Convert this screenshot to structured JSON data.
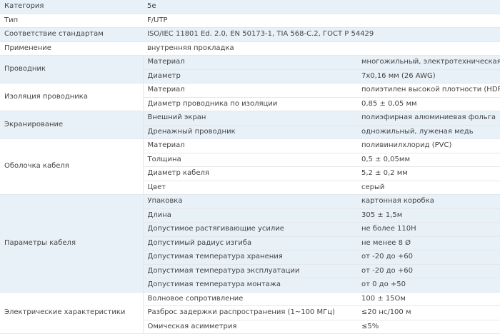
{
  "spec_rows": [
    {
      "label": "Категория",
      "value": "5e"
    },
    {
      "label": "Тип",
      "value": "F/UTP"
    },
    {
      "label": "Соответствие стандартам",
      "value": "ISO/IEC 11801 Ed. 2.0, EN 50173-1, TIA 568-C.2, ГОСТ Р 54429"
    },
    {
      "label": "Применение",
      "value": "внутренняя прокладка"
    }
  ],
  "groups": [
    {
      "title": "Проводник",
      "rows": [
        {
          "param": "Материал",
          "value": "многожильный, электротехническая медь"
        },
        {
          "param": "Диаметр",
          "value": "7x0,16 мм (26 AWG)"
        }
      ]
    },
    {
      "title": "Изоляция проводника",
      "rows": [
        {
          "param": "Материал",
          "value": "полиэтилен высокой плотности (HDPE)"
        },
        {
          "param": "Диаметр проводника по изоляции",
          "value": "0,85 ± 0,05 мм"
        }
      ]
    },
    {
      "title": "Экранирование",
      "rows": [
        {
          "param": "Внешний экран",
          "value": "полиэфирная алюминиевая фольга"
        },
        {
          "param": "Дренажный проводник",
          "value": "одножильный, луженая медь"
        }
      ]
    },
    {
      "title": "Оболочка кабеля",
      "rows": [
        {
          "param": "Материал",
          "value": "поливинилхлорид (PVC)"
        },
        {
          "param": "Толщина",
          "value": "0,5 ± 0,05мм"
        },
        {
          "param": "Диаметр кабеля",
          "value": "5,2 ± 0,2 мм"
        },
        {
          "param": "Цвет",
          "value": "серый"
        }
      ]
    },
    {
      "title": "Параметры кабеля",
      "rows": [
        {
          "param": "Упаковка",
          "value": "картонная коробка"
        },
        {
          "param": "Длина",
          "value": "305 ± 1,5м"
        },
        {
          "param": "Допустимое растягивающие усилие",
          "value": "не более 110Н"
        },
        {
          "param": "Допустимый радиус изгиба",
          "value": "не менее 8 Ø"
        },
        {
          "param": "Допустимая температура хранения",
          "value": "от -20 до +60"
        },
        {
          "param": "Допустимая температура эксплуатации",
          "value": "от -20 до +60"
        },
        {
          "param": "Допустимая температура монтажа",
          "value": "от 0 до +50"
        }
      ]
    },
    {
      "title": "Электрические характеристики",
      "rows": [
        {
          "param": "Волновое сопротивление",
          "value": "100 ± 15Ом"
        },
        {
          "param": "Разброс задержки распространения (1~100 МГц)",
          "value": "≤20 нс/100 м"
        },
        {
          "param": "Омическая асимметрия",
          "value": "≤5%"
        }
      ]
    }
  ]
}
